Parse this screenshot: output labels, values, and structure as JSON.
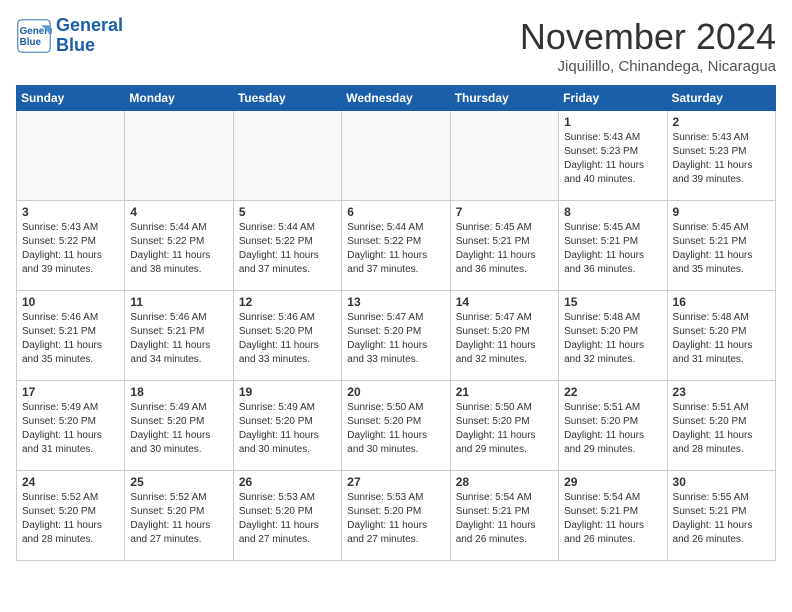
{
  "header": {
    "logo_line1": "General",
    "logo_line2": "Blue",
    "month": "November 2024",
    "location": "Jiquilillo, Chinandega, Nicaragua"
  },
  "weekdays": [
    "Sunday",
    "Monday",
    "Tuesday",
    "Wednesday",
    "Thursday",
    "Friday",
    "Saturday"
  ],
  "weeks": [
    [
      {
        "day": "",
        "info": "",
        "empty": true
      },
      {
        "day": "",
        "info": "",
        "empty": true
      },
      {
        "day": "",
        "info": "",
        "empty": true
      },
      {
        "day": "",
        "info": "",
        "empty": true
      },
      {
        "day": "",
        "info": "",
        "empty": true
      },
      {
        "day": "1",
        "info": "Sunrise: 5:43 AM\nSunset: 5:23 PM\nDaylight: 11 hours\nand 40 minutes."
      },
      {
        "day": "2",
        "info": "Sunrise: 5:43 AM\nSunset: 5:23 PM\nDaylight: 11 hours\nand 39 minutes."
      }
    ],
    [
      {
        "day": "3",
        "info": "Sunrise: 5:43 AM\nSunset: 5:22 PM\nDaylight: 11 hours\nand 39 minutes."
      },
      {
        "day": "4",
        "info": "Sunrise: 5:44 AM\nSunset: 5:22 PM\nDaylight: 11 hours\nand 38 minutes."
      },
      {
        "day": "5",
        "info": "Sunrise: 5:44 AM\nSunset: 5:22 PM\nDaylight: 11 hours\nand 37 minutes."
      },
      {
        "day": "6",
        "info": "Sunrise: 5:44 AM\nSunset: 5:22 PM\nDaylight: 11 hours\nand 37 minutes."
      },
      {
        "day": "7",
        "info": "Sunrise: 5:45 AM\nSunset: 5:21 PM\nDaylight: 11 hours\nand 36 minutes."
      },
      {
        "day": "8",
        "info": "Sunrise: 5:45 AM\nSunset: 5:21 PM\nDaylight: 11 hours\nand 36 minutes."
      },
      {
        "day": "9",
        "info": "Sunrise: 5:45 AM\nSunset: 5:21 PM\nDaylight: 11 hours\nand 35 minutes."
      }
    ],
    [
      {
        "day": "10",
        "info": "Sunrise: 5:46 AM\nSunset: 5:21 PM\nDaylight: 11 hours\nand 35 minutes."
      },
      {
        "day": "11",
        "info": "Sunrise: 5:46 AM\nSunset: 5:21 PM\nDaylight: 11 hours\nand 34 minutes."
      },
      {
        "day": "12",
        "info": "Sunrise: 5:46 AM\nSunset: 5:20 PM\nDaylight: 11 hours\nand 33 minutes."
      },
      {
        "day": "13",
        "info": "Sunrise: 5:47 AM\nSunset: 5:20 PM\nDaylight: 11 hours\nand 33 minutes."
      },
      {
        "day": "14",
        "info": "Sunrise: 5:47 AM\nSunset: 5:20 PM\nDaylight: 11 hours\nand 32 minutes."
      },
      {
        "day": "15",
        "info": "Sunrise: 5:48 AM\nSunset: 5:20 PM\nDaylight: 11 hours\nand 32 minutes."
      },
      {
        "day": "16",
        "info": "Sunrise: 5:48 AM\nSunset: 5:20 PM\nDaylight: 11 hours\nand 31 minutes."
      }
    ],
    [
      {
        "day": "17",
        "info": "Sunrise: 5:49 AM\nSunset: 5:20 PM\nDaylight: 11 hours\nand 31 minutes."
      },
      {
        "day": "18",
        "info": "Sunrise: 5:49 AM\nSunset: 5:20 PM\nDaylight: 11 hours\nand 30 minutes."
      },
      {
        "day": "19",
        "info": "Sunrise: 5:49 AM\nSunset: 5:20 PM\nDaylight: 11 hours\nand 30 minutes."
      },
      {
        "day": "20",
        "info": "Sunrise: 5:50 AM\nSunset: 5:20 PM\nDaylight: 11 hours\nand 30 minutes."
      },
      {
        "day": "21",
        "info": "Sunrise: 5:50 AM\nSunset: 5:20 PM\nDaylight: 11 hours\nand 29 minutes."
      },
      {
        "day": "22",
        "info": "Sunrise: 5:51 AM\nSunset: 5:20 PM\nDaylight: 11 hours\nand 29 minutes."
      },
      {
        "day": "23",
        "info": "Sunrise: 5:51 AM\nSunset: 5:20 PM\nDaylight: 11 hours\nand 28 minutes."
      }
    ],
    [
      {
        "day": "24",
        "info": "Sunrise: 5:52 AM\nSunset: 5:20 PM\nDaylight: 11 hours\nand 28 minutes."
      },
      {
        "day": "25",
        "info": "Sunrise: 5:52 AM\nSunset: 5:20 PM\nDaylight: 11 hours\nand 27 minutes."
      },
      {
        "day": "26",
        "info": "Sunrise: 5:53 AM\nSunset: 5:20 PM\nDaylight: 11 hours\nand 27 minutes."
      },
      {
        "day": "27",
        "info": "Sunrise: 5:53 AM\nSunset: 5:20 PM\nDaylight: 11 hours\nand 27 minutes."
      },
      {
        "day": "28",
        "info": "Sunrise: 5:54 AM\nSunset: 5:21 PM\nDaylight: 11 hours\nand 26 minutes."
      },
      {
        "day": "29",
        "info": "Sunrise: 5:54 AM\nSunset: 5:21 PM\nDaylight: 11 hours\nand 26 minutes."
      },
      {
        "day": "30",
        "info": "Sunrise: 5:55 AM\nSunset: 5:21 PM\nDaylight: 11 hours\nand 26 minutes."
      }
    ]
  ]
}
